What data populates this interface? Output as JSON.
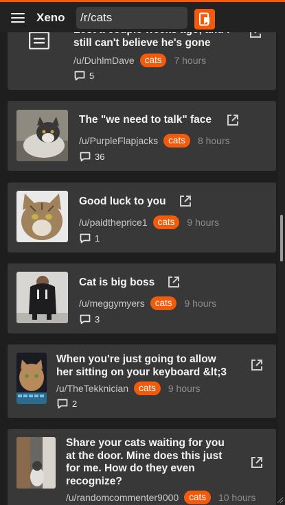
{
  "app": {
    "name": "Xeno"
  },
  "search": {
    "value": "/r/cats"
  },
  "posts": [
    {
      "title_line1": "Lost a couple weeks ago, and I",
      "title_line2": "still can't believe he's gone",
      "author": "/u/DuhlmDave",
      "subreddit": "cats",
      "time": "7 hours",
      "comments": "5"
    },
    {
      "title": "The \"we need to talk\" face",
      "author": "/u/PurpleFlapjacks",
      "subreddit": "cats",
      "time": "8 hours",
      "comments": "36"
    },
    {
      "title": "Good luck to you",
      "author": "/u/paidtheprice1",
      "subreddit": "cats",
      "time": "9 hours",
      "comments": "1"
    },
    {
      "title": "Cat is big boss",
      "author": "/u/meggymyers",
      "subreddit": "cats",
      "time": "9 hours",
      "comments": "3"
    },
    {
      "title_line1": "When you're just going to allow",
      "title_line2": "her sitting on your keyboard &lt;3",
      "author": "/u/TheTekknician",
      "subreddit": "cats",
      "time": "9 hours",
      "comments": "2"
    },
    {
      "title_line1": "Share your cats waiting for you",
      "title_line2": "at the door. Mine does this just",
      "title_line3": "for me. How do they even",
      "title_line4": "recognize?",
      "author": "/u/randomcommenter9000",
      "subreddit": "cats",
      "time": "10 hours"
    }
  ],
  "colors": {
    "accent": "#f25a0c",
    "card": "#383838",
    "background": "#1e1e1e"
  },
  "icons": [
    "menu-icon",
    "text-post-icon",
    "external-link-icon",
    "comment-icon",
    "bookmark-icon"
  ]
}
